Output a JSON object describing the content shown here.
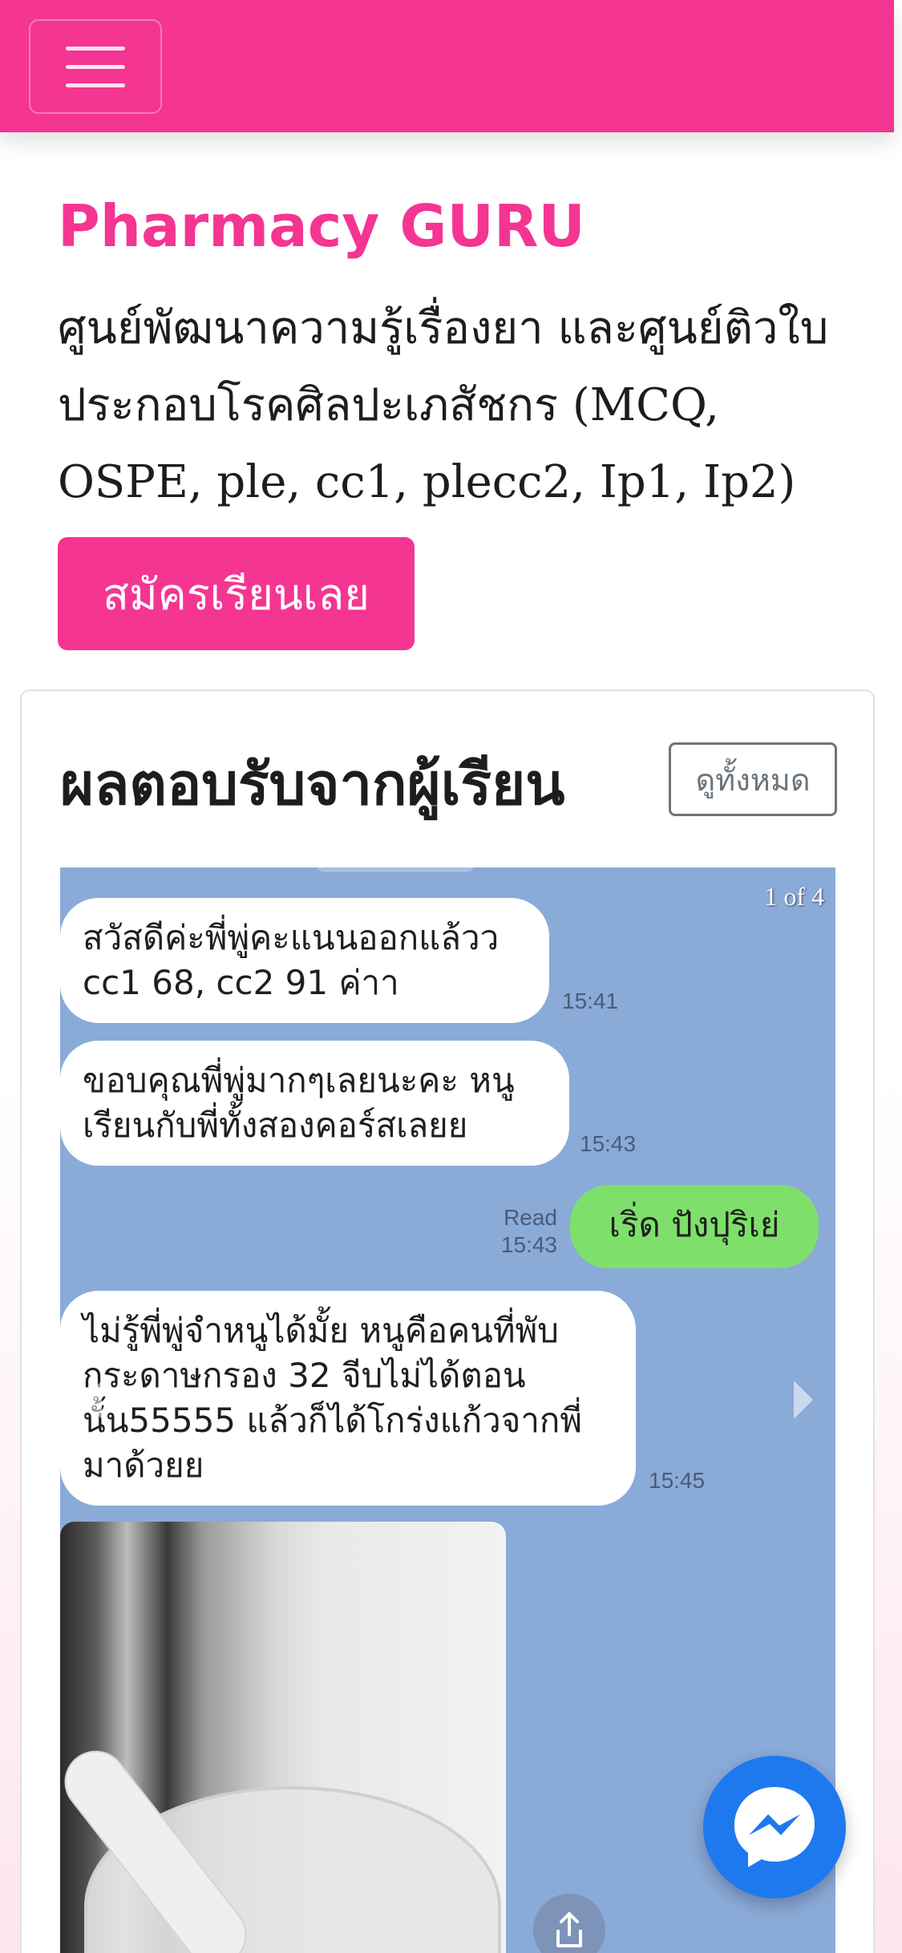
{
  "nav": {
    "menu_icon": "hamburger-menu-icon"
  },
  "hero": {
    "brand": "Pharmacy GURU",
    "tagline": "ศูนย์พัฒนาความรู้เรื่องยา และศูนย์ติวใบประกอบโรคศิลปะเภสัชกร (MCQ, OSPE, ple, cc1, plecc2, Ip1, Ip2)",
    "signup_label": "สมัครเรียนเลย"
  },
  "testimonials": {
    "title": "ผลตอบรับจากผู้เรียน",
    "view_all_label": "ดูทั้งหมด",
    "slide_counter": "1 of 4",
    "messages": [
      {
        "text": "สวัสดีค่ะพี่พู่คะแนนออกแล้วว cc1 68, cc2 91 ค่าา",
        "time": "15:41"
      },
      {
        "text": "ขอบคุณพี่พู่มากๆเลยนะคะ หนูเรียนกับพี่ทั้งสองคอร์สเลยย",
        "time": "15:43"
      },
      {
        "text": "เริ่ด ปังปุริเย่",
        "read": "Read",
        "time": "15:43"
      },
      {
        "text": "ไม่รู้พี่พู่จำหนูได้มั้ย หนูคือคนที่พับกระดาษกรอง 32 จีบไม่ได้ตอนนั้น55555 แล้วก็ได้โกร่งแก้วจากพี่มาด้วยย",
        "time": "15:45"
      }
    ],
    "prev_icon": "chevron-left-icon",
    "next_icon": "chevron-right-icon",
    "share_icon": "share-icon"
  },
  "floating": {
    "messenger_icon": "messenger-icon"
  },
  "colors": {
    "brand_pink": "#f43592",
    "chat_bg": "#8aaad8",
    "chat_green": "#7ee06b",
    "messenger_blue": "#1e79ef"
  }
}
